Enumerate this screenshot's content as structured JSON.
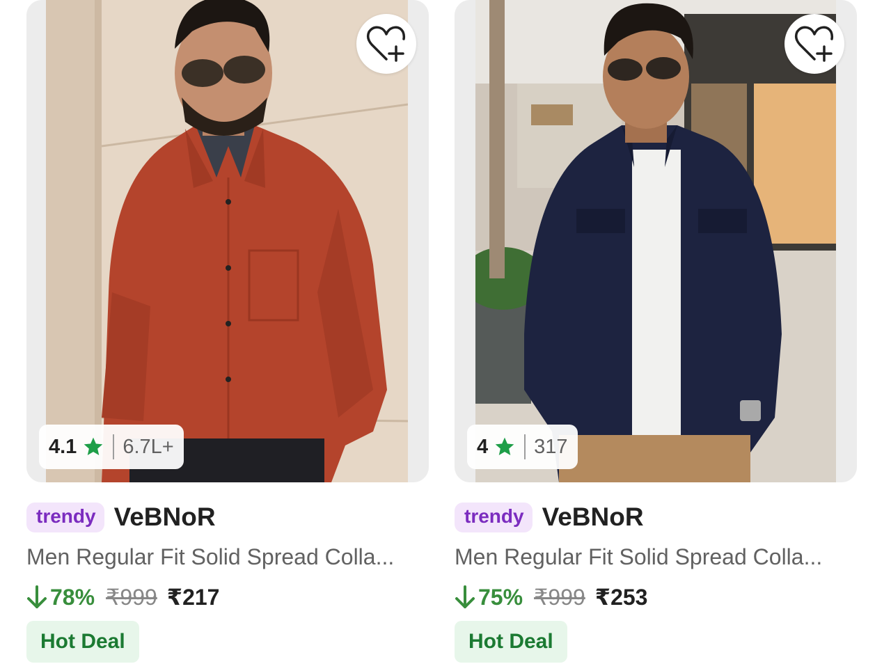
{
  "colors": {
    "accent_green": "#388e3c",
    "star_green": "#1e9e48",
    "trendy_bg": "#f3e5fb",
    "trendy_text": "#7b2cbf",
    "hot_deal_bg": "#e7f6ea",
    "hot_deal_text": "#1b7a32"
  },
  "products": [
    {
      "rating": "4.1",
      "rating_icon": "star-icon",
      "rating_count": "6.7L+",
      "badge": "trendy",
      "brand": "VeBNoR",
      "title": "Men Regular Fit Solid Spread Colla...",
      "discount": "78%",
      "mrp": "₹999",
      "price": "₹217",
      "deal_label": "Hot Deal",
      "wishlist_icon": "heart-plus-icon"
    },
    {
      "rating": "4",
      "rating_icon": "star-icon",
      "rating_count": "317",
      "badge": "trendy",
      "brand": "VeBNoR",
      "title": "Men Regular Fit Solid Spread Colla...",
      "discount": "75%",
      "mrp": "₹999",
      "price": "₹253",
      "deal_label": "Hot Deal",
      "wishlist_icon": "heart-plus-icon"
    }
  ]
}
